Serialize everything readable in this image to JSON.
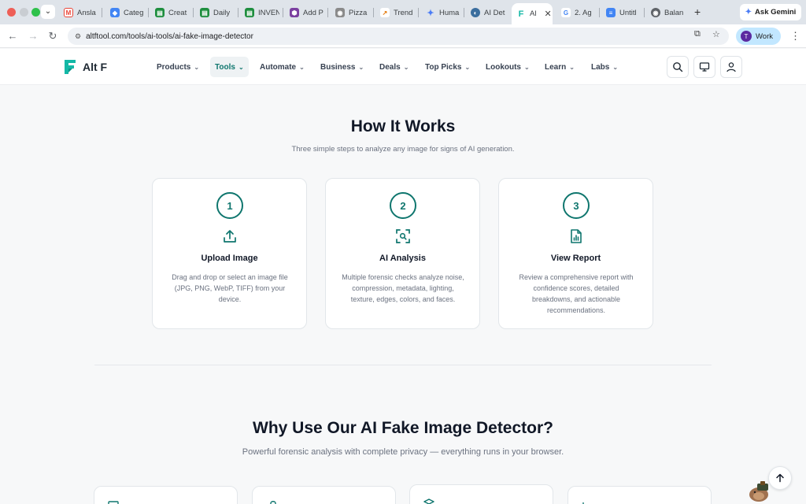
{
  "browser": {
    "tabs": [
      {
        "label": "Ansla",
        "icon": "gmail-icon",
        "color": "#ea4335"
      },
      {
        "label": "Categ",
        "icon": "diamond-icon",
        "color": "#4285f4"
      },
      {
        "label": "Creat",
        "icon": "sheets-icon",
        "color": "#1e8e3e"
      },
      {
        "label": "Daily",
        "icon": "sheets-icon",
        "color": "#1e8e3e"
      },
      {
        "label": "INVEN",
        "icon": "sheets-icon",
        "color": "#1e8e3e"
      },
      {
        "label": "Add P",
        "icon": "purple-hex-icon",
        "color": "#7b3fa0"
      },
      {
        "label": "Pizza",
        "icon": "globe-icon",
        "color": "#8a8a8a"
      },
      {
        "label": "Trend",
        "icon": "trend-icon",
        "color": "#e37400"
      },
      {
        "label": "Huma",
        "icon": "gemini-icon",
        "color": "#4a7cf6"
      },
      {
        "label": "AI Det",
        "icon": "half-circle-icon",
        "color": "#3b6e9e"
      },
      {
        "label": "Al",
        "icon": "altf-icon",
        "color": "#14b8a6"
      },
      {
        "label": "2. Ag",
        "icon": "google-icon",
        "color": "#4285f4"
      },
      {
        "label": "Untitl",
        "icon": "docs-icon",
        "color": "#4285f4"
      },
      {
        "label": "Balan",
        "icon": "globe-icon",
        "color": "#5f6368"
      }
    ],
    "ask_gemini": "Ask Gemini",
    "url": "altftool.com/tools/ai-tools/ai-fake-image-detector",
    "profile_initial": "T",
    "profile_label": "Work"
  },
  "site": {
    "brand": "Alt F",
    "nav": [
      "Products",
      "Tools",
      "Automate",
      "Business",
      "Deals",
      "Top Picks",
      "Lookouts",
      "Learn",
      "Labs"
    ],
    "active_nav": "Tools",
    "accent": "#0f766e"
  },
  "how": {
    "title": "How It Works",
    "subtitle": "Three simple steps to analyze any image for signs of AI generation.",
    "steps": [
      {
        "num": "1",
        "icon": "upload-icon",
        "title": "Upload Image",
        "desc": "Drag and drop or select an image file (JPG, PNG, WebP, TIFF) from your device."
      },
      {
        "num": "2",
        "icon": "scan-search-icon",
        "title": "AI Analysis",
        "desc": "Multiple forensic checks analyze noise, compression, metadata, lighting, texture, edges, colors, and faces."
      },
      {
        "num": "3",
        "icon": "report-chart-icon",
        "title": "View Report",
        "desc": "Review a comprehensive report with confidence scores, detailed breakdowns, and actionable recommendations."
      }
    ]
  },
  "why": {
    "title": "Why Use Our AI Fake Image Detector?",
    "subtitle": "Powerful forensic analysis with complete privacy — everything runs in your browser."
  }
}
